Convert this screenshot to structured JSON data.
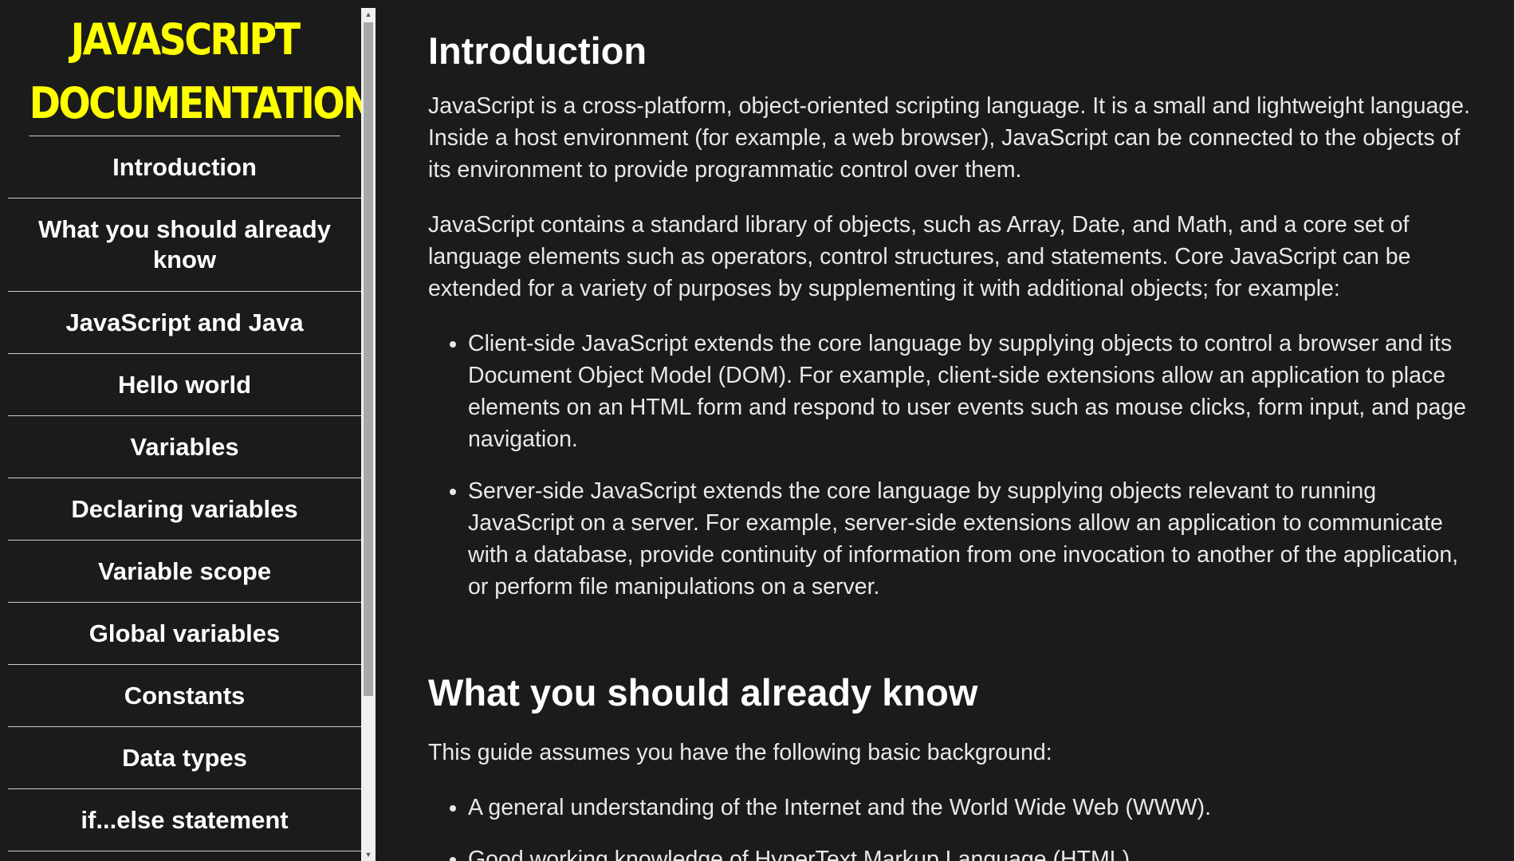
{
  "sidebar": {
    "title_line1": "JAVASCRIPT",
    "title_line2": "DOCUMENTATION",
    "items": [
      {
        "label": "Introduction"
      },
      {
        "label": "What you should already know"
      },
      {
        "label": "JavaScript and Java"
      },
      {
        "label": "Hello world"
      },
      {
        "label": "Variables"
      },
      {
        "label": "Declaring variables"
      },
      {
        "label": "Variable scope"
      },
      {
        "label": "Global variables"
      },
      {
        "label": "Constants"
      },
      {
        "label": "Data types"
      },
      {
        "label": "if...else statement"
      }
    ]
  },
  "main": {
    "sections": [
      {
        "title": "Introduction",
        "paragraphs": [
          "JavaScript is a cross-platform, object-oriented scripting language. It is a small and lightweight language. Inside a host environment (for example, a web browser), JavaScript can be connected to the objects of its environment to provide programmatic control over them.",
          "JavaScript contains a standard library of objects, such as Array, Date, and Math, and a core set of language elements such as operators, control structures, and statements. Core JavaScript can be extended for a variety of purposes by supplementing it with additional objects; for example:"
        ],
        "bullets": [
          "Client-side JavaScript extends the core language by supplying objects to control a browser and its Document Object Model (DOM). For example, client-side extensions allow an application to place elements on an HTML form and respond to user events such as mouse clicks, form input, and page navigation.",
          "Server-side JavaScript extends the core language by supplying objects relevant to running JavaScript on a server. For example, server-side extensions allow an application to communicate with a database, provide continuity of information from one invocation to another of the application, or perform file manipulations on a server."
        ]
      },
      {
        "title": "What you should already know",
        "paragraphs": [
          "This guide assumes you have the following basic background:"
        ],
        "bullets": [
          "A general understanding of the Internet and the World Wide Web (WWW).",
          "Good working knowledge of HyperText Markup Language (HTML)."
        ]
      }
    ]
  },
  "colors": {
    "background": "#1b1b1b",
    "title_accent": "#ffff00",
    "text": "#ffffff"
  }
}
